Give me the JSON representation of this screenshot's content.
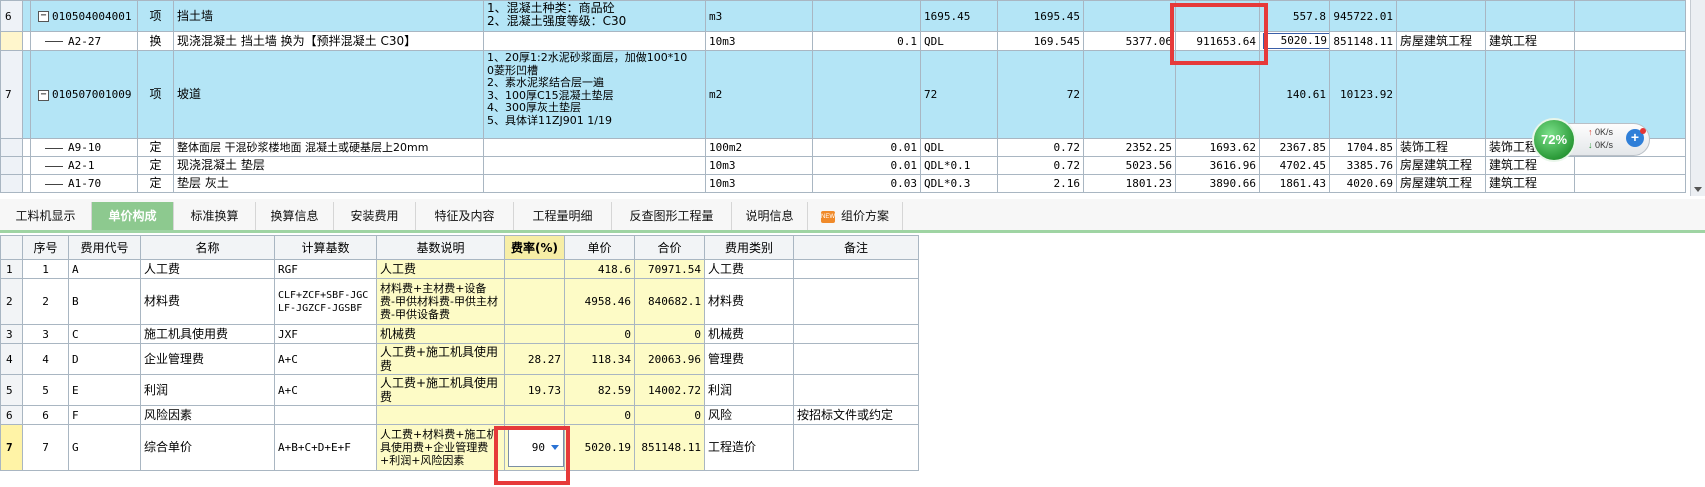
{
  "top_rows": [
    {
      "row_no": "6",
      "code": "010504004001",
      "type": "项",
      "name": "挡土墙",
      "features": [
        "1、混凝土种类：商品砼",
        "2、混凝土强度等级：C30"
      ],
      "unit": "m3",
      "qty_expr": "",
      "qty_formula": "1695.45",
      "quantity": "1695.45",
      "c1": "",
      "c2": "",
      "unit_price": "557.8",
      "total": "945722.01",
      "cat1": "",
      "cat2": ""
    },
    {
      "row_no": "",
      "code": "A2-27",
      "type": "换",
      "name": "现浇混凝土 挡土墙  换为【预拌混凝土 C30】",
      "features": [],
      "unit": "10m3",
      "qty_expr": "0.1",
      "qty_formula": "QDL",
      "quantity": "169.545",
      "c1": "5377.06",
      "c2": "911653.64",
      "unit_price": "5020.19",
      "total": "851148.11",
      "cat1": "房屋建筑工程",
      "cat2": "建筑工程"
    },
    {
      "row_no": "7",
      "code": "010507001009",
      "type": "项",
      "name": "坡道",
      "features": [
        "1、20厚1:2水泥砂浆面层，加做100*10",
        "0菱形凹槽",
        "2、素水泥浆结合层一遍",
        "3、100厚C15混凝土垫层",
        "4、300厚灰土垫层",
        "5、具体详11ZJ901 1/19"
      ],
      "unit": "m2",
      "qty_expr": "",
      "qty_formula": "72",
      "quantity": "72",
      "c1": "",
      "c2": "",
      "unit_price": "140.61",
      "total": "10123.92",
      "cat1": "",
      "cat2": ""
    },
    {
      "row_no": "",
      "code": "A9-10",
      "type": "定",
      "name": "整体面层 干混砂浆楼地面 混凝土或硬基层上20mm",
      "features": [],
      "unit": "100m2",
      "qty_expr": "0.01",
      "qty_formula": "QDL",
      "quantity": "0.72",
      "c1": "2352.25",
      "c2": "1693.62",
      "unit_price": "2367.85",
      "total": "1704.85",
      "cat1": "装饰工程",
      "cat2": "装饰工程"
    },
    {
      "row_no": "",
      "code": "A2-1",
      "type": "定",
      "name": "现浇混凝土 垫层",
      "features": [],
      "unit": "10m3",
      "qty_expr": "0.01",
      "qty_formula": "QDL*0.1",
      "quantity": "0.72",
      "c1": "5023.56",
      "c2": "3616.96",
      "unit_price": "4702.45",
      "total": "3385.76",
      "cat1": "房屋建筑工程",
      "cat2": "建筑工程"
    },
    {
      "row_no": "",
      "code": "A1-70",
      "type": "定",
      "name": "垫层 灰土",
      "features": [],
      "unit": "10m3",
      "qty_expr": "0.03",
      "qty_formula": "QDL*0.3",
      "quantity": "2.16",
      "c1": "1801.23",
      "c2": "3890.66",
      "unit_price": "1861.43",
      "total": "4020.69",
      "cat1": "房屋建筑工程",
      "cat2": "建筑工程"
    }
  ],
  "speed_widget": {
    "percent": "72%",
    "upload": "0K/s",
    "download": "0K/s"
  },
  "tabs": [
    "工料机显示",
    "单价构成",
    "标准换算",
    "换算信息",
    "安装费用",
    "特征及内容",
    "工程量明细",
    "反查图形工程量",
    "说明信息",
    "组价方案"
  ],
  "new_badge": "NEW",
  "cost_table": {
    "headers": [
      "序号",
      "费用代号",
      "名称",
      "计算基数",
      "基数说明",
      "费率(%)",
      "单价",
      "合价",
      "费用类别",
      "备注"
    ],
    "rows": [
      {
        "row": "1",
        "seq": "1",
        "code": "A",
        "name": "人工费",
        "base": "RGF",
        "desc": "人工费",
        "rate": "",
        "price": "418.6",
        "amount": "70971.54",
        "category": "人工费",
        "remark": ""
      },
      {
        "row": "2",
        "seq": "2",
        "code": "B",
        "name": "材料费",
        "base": "CLF+ZCF+SBF-JGCLF-JGZCF-JGSBF",
        "desc": "材料费+主材费+设备费-甲供材料费-甲供主材费-甲供设备费",
        "rate": "",
        "price": "4958.46",
        "amount": "840682.1",
        "category": "材料费",
        "remark": ""
      },
      {
        "row": "3",
        "seq": "3",
        "code": "C",
        "name": "施工机具使用费",
        "base": "JXF",
        "desc": "机械费",
        "rate": "",
        "price": "0",
        "amount": "0",
        "category": "机械费",
        "remark": ""
      },
      {
        "row": "4",
        "seq": "4",
        "code": "D",
        "name": "企业管理费",
        "base": "A+C",
        "desc": "人工费+施工机具使用费",
        "rate": "28.27",
        "price": "118.34",
        "amount": "20063.96",
        "category": "管理费",
        "remark": ""
      },
      {
        "row": "5",
        "seq": "5",
        "code": "E",
        "name": "利润",
        "base": "A+C",
        "desc": "人工费+施工机具使用费",
        "rate": "19.73",
        "price": "82.59",
        "amount": "14002.72",
        "category": "利润",
        "remark": ""
      },
      {
        "row": "6",
        "seq": "6",
        "code": "F",
        "name": "风险因素",
        "base": "",
        "desc": "",
        "rate": "",
        "price": "0",
        "amount": "0",
        "category": "风险",
        "remark": "按招标文件或约定"
      },
      {
        "row": "7",
        "seq": "7",
        "code": "G",
        "name": "综合单价",
        "base": "A+B+C+D+E+F",
        "desc": "人工费+材料费+施工机具使用费+企业管理费+利润+风险因素",
        "rate": "90",
        "price": "5020.19",
        "amount": "851148.11",
        "category": "工程造价",
        "remark": ""
      }
    ]
  },
  "colors": {
    "row_blue": "#b4e5f6",
    "active_tab": "#8dc98f",
    "highlight": "#e63a3a",
    "cell_yellow": "#fdfbc6"
  }
}
